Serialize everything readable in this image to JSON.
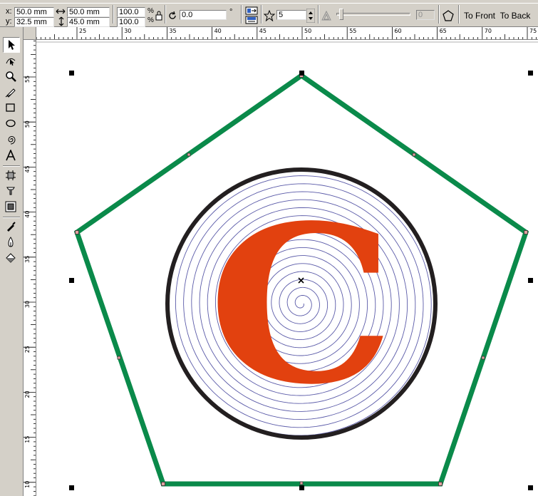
{
  "property_bar": {
    "x_label": "x:",
    "x_value": "50.0 mm",
    "y_label": "y:",
    "y_value": "32.5 mm",
    "width_value": "50.0 mm",
    "height_value": "45.0 mm",
    "scale_w": "100.0",
    "scale_h": "100.0",
    "percent_w": "%",
    "percent_h": "%",
    "rotation_value": "0.0",
    "degree_symbol": "°",
    "polygon_points": "5",
    "sharpness_value": "0",
    "to_front_label": "To Front",
    "to_back_label": "To Back"
  },
  "horizontal_ruler": {
    "ticks": [
      "25",
      "30",
      "35",
      "40",
      "45",
      "50",
      "55",
      "60",
      "65",
      "70",
      "75"
    ]
  },
  "vertical_ruler": {
    "ticks": [
      "55",
      "50",
      "45",
      "40",
      "35",
      "30",
      "25",
      "20",
      "15",
      "10"
    ]
  },
  "toolbox": {
    "tools": [
      "pick-tool",
      "shape-tool",
      "zoom-tool",
      "freehand-tool",
      "rectangle-tool",
      "ellipse-tool",
      "spiral-tool",
      "text-tool",
      "interactive-blend-tool",
      "eyedropper-tool",
      "interactive-fill-tool",
      "outline-tool",
      "fill-tool",
      "interactive-fill-bucket-tool"
    ]
  },
  "drawing": {
    "letter": "C",
    "colors": {
      "pentagon_outline": "#0a8a4a",
      "circle_outline": "#231f20",
      "spiral_stroke": "#5a5aa8",
      "letter_fill": "#e2410f"
    }
  }
}
